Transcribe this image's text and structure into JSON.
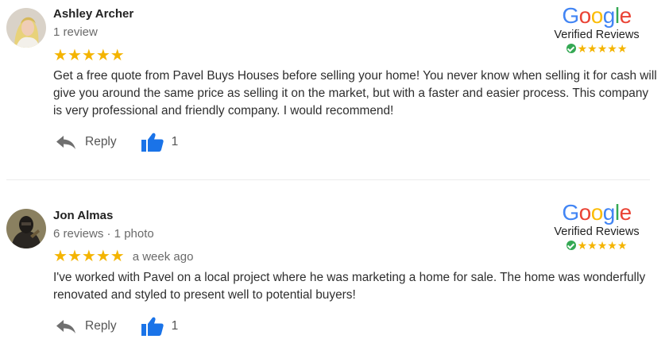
{
  "brand_colors": {
    "blue": "#4285F4",
    "red": "#EA4335",
    "yellow": "#FBBC05",
    "green": "#34A853",
    "star": "#F4B400"
  },
  "badge": {
    "logo_letters": [
      "G",
      "o",
      "o",
      "g",
      "l",
      "e"
    ],
    "verified_label": "Verified Reviews",
    "rating": 5
  },
  "reviews": [
    {
      "name": "Ashley Archer",
      "meta": "1 review",
      "rating": 5,
      "when": "",
      "text": "Get a free quote from Pavel Buys Houses before selling your home! You never know when selling it for cash will give you around the same price as selling it on the market, but with a faster and easier process. This company is very professional and friendly company. I would recommend!",
      "reply_label": "Reply",
      "likes": "1"
    },
    {
      "name": "Jon Almas",
      "meta": "6 reviews · 1 photo",
      "rating": 5,
      "when": "a week ago",
      "text": "I've worked with Pavel on a local project where he was marketing a home for sale. The home was wonderfully renovated and styled to present well to potential buyers!",
      "reply_label": "Reply",
      "likes": "1"
    }
  ]
}
